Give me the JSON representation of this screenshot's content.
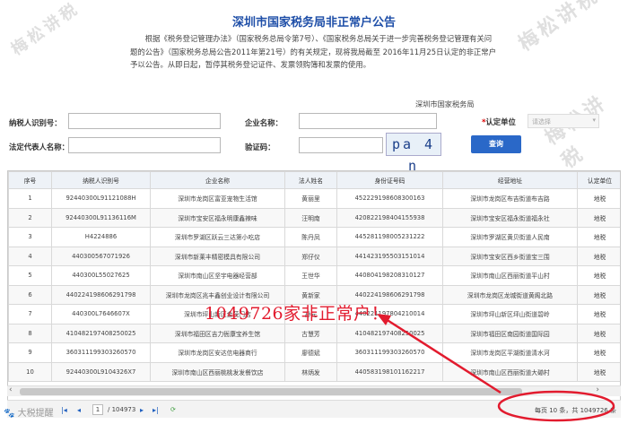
{
  "watermark": "梅松讲税",
  "title": "深圳市国家税务局非正常户公告",
  "notice": "根据《税务登记管理办法》（国家税务总局令第7号）、《国家税务总局关于进一步完善税务登记管理有关问题的公告》（国家税务总局公告2011年第21号）的有关规定，现将我局截至 2016年11月25日认定的非正常户予以公告。从即日起，暂停其税务登记证件、发票领购簿和发票的使用。",
  "signer": "深圳市国家税务局",
  "form": {
    "taxpayer_id_label": "纳税人识别号：",
    "company_name_label": "企业名称：",
    "unit_label": "认定单位",
    "unit_required": "*",
    "unit_select_value": "请选择",
    "legal_rep_label": "法定代表人名称：",
    "captcha_label": "验证码：",
    "captcha_text": "pa 4 n",
    "query_button": "查询"
  },
  "table": {
    "headers": [
      "序号",
      "纳税人识别号",
      "企业名称",
      "法人姓名",
      "身份证号码",
      "经营地址",
      "认定单位"
    ],
    "rows": [
      [
        "1",
        "92440300L91121088H",
        "深圳市龙岗区富亚宠物生活馆",
        "黄丽里",
        "452229198608300163",
        "深圳市龙岗区布吉街道布吉路",
        "地税"
      ],
      [
        "2",
        "92440300L91136116M",
        "深圳市宝安区福永明康鑫辣味",
        "汪明南",
        "420822198404155938",
        "深圳市宝安区福永街道福永社",
        "地税"
      ],
      [
        "3",
        "H4224886",
        "深圳市罗湖区跃云三达第小吃店",
        "陈丹凤",
        "445281198005231222",
        "深圳市罗湖区黄贝街道人民南",
        "地税"
      ],
      [
        "4",
        "440300567071926",
        "深圳市新莱丰精密模具有限公司",
        "郑仔仪",
        "441423195503151014",
        "深圳市宝安区西乡街道宝三围",
        "地税"
      ],
      [
        "5",
        "440300L55027625",
        "深圳市南山区坚宇电器经营部",
        "王世华",
        "440804198208310127",
        "深圳市南山区西丽街道平山村",
        "地税"
      ],
      [
        "6",
        "440224198606291798",
        "深圳市龙岗区兆丰鑫创业设计有限公司",
        "黄新家",
        "440224198606291798",
        "深圳市龙岗区龙城街道黄阁北路",
        "地税"
      ],
      [
        "7",
        "440300L7646607X",
        "深圳市坪山新区金茂门店",
        "孙元",
        "440221197804210014",
        "深圳市坪山新区坪山街道碧岭",
        "地税"
      ],
      [
        "8",
        "410482197408250025",
        "深圳市福田区吉力衙康宝养生馆",
        "古慧芳",
        "410482197408250025",
        "深圳市福田区南园街道国际园",
        "地税"
      ],
      [
        "9",
        "360311199303260570",
        "深圳市龙岗区安达信电器商行",
        "廖德斌",
        "360311199303260570",
        "深圳市龙岗区平湖街道清水河",
        "地税"
      ],
      [
        "10",
        "92440300L9104326X7",
        "深圳市南山区西丽桃桃发发餐饮店",
        "林炳发",
        "440583198101162217",
        "深圳市南山区西丽街道大磡村",
        "地税"
      ]
    ]
  },
  "pager": {
    "page_input": "1",
    "total_pages": "/ 104973",
    "summary": "每页 10 条，共 1049726 条"
  },
  "annotation": "1049726家非正常户！",
  "brand": "🐾 大税提醒",
  "colors": {
    "title": "#1f4fa8",
    "button": "#2a68c8",
    "annotation": "#e21b2e"
  }
}
